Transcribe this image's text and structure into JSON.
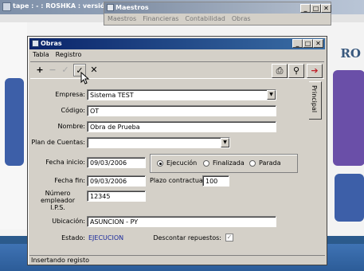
{
  "background_app": {
    "title": "tape : - : ROSHKA : versión",
    "logo_text": "RO"
  },
  "maestros": {
    "title": "Maestros",
    "menu": [
      "Maestros",
      "Financieras",
      "Contabilidad",
      "Obras"
    ]
  },
  "obras": {
    "title": "Obras",
    "menu": [
      "Tabla",
      "Registro"
    ],
    "toolbar": {
      "add": "+",
      "remove": "−",
      "cancel_edit": "✓",
      "confirm": "✓",
      "close": "✕"
    },
    "side_tab": "Principal",
    "labels": {
      "empresa": "Empresa:",
      "codigo": "Código:",
      "nombre": "Nombre:",
      "plan": "Plan de Cuentas:",
      "fecha_inicio": "Fecha inicio:",
      "fecha_fin": "Fecha fin:",
      "plazo": "Plazo contractual:",
      "numero_empleador_1": "Número",
      "numero_empleador_2": "empleador",
      "numero_empleador_3": "I.P.S.",
      "ubicacion": "Ubicación:",
      "estado": "Estado:",
      "descontar": "Descontar repuestos:"
    },
    "values": {
      "empresa": "Sistema TEST",
      "codigo": "OT",
      "nombre": "Obra de Prueba",
      "plan": "",
      "fecha_inicio": "09/03/2006",
      "fecha_fin": "09/03/2006",
      "plazo": "100",
      "numero_empleador": "12345",
      "ubicacion": "ASUNCION - PY",
      "estado": "EJECUCION",
      "descontar_checked": true
    },
    "estado_options": [
      "Ejecución",
      "Finalizada",
      "Parada"
    ],
    "estado_selected": "Ejecución",
    "status": "Insertando registo"
  },
  "colors": {
    "obras_title_start": "#0a246a",
    "obras_title_end": "#3a6ea5",
    "estado_text": "#1b2a9c",
    "window_face": "#d4d0c8"
  }
}
